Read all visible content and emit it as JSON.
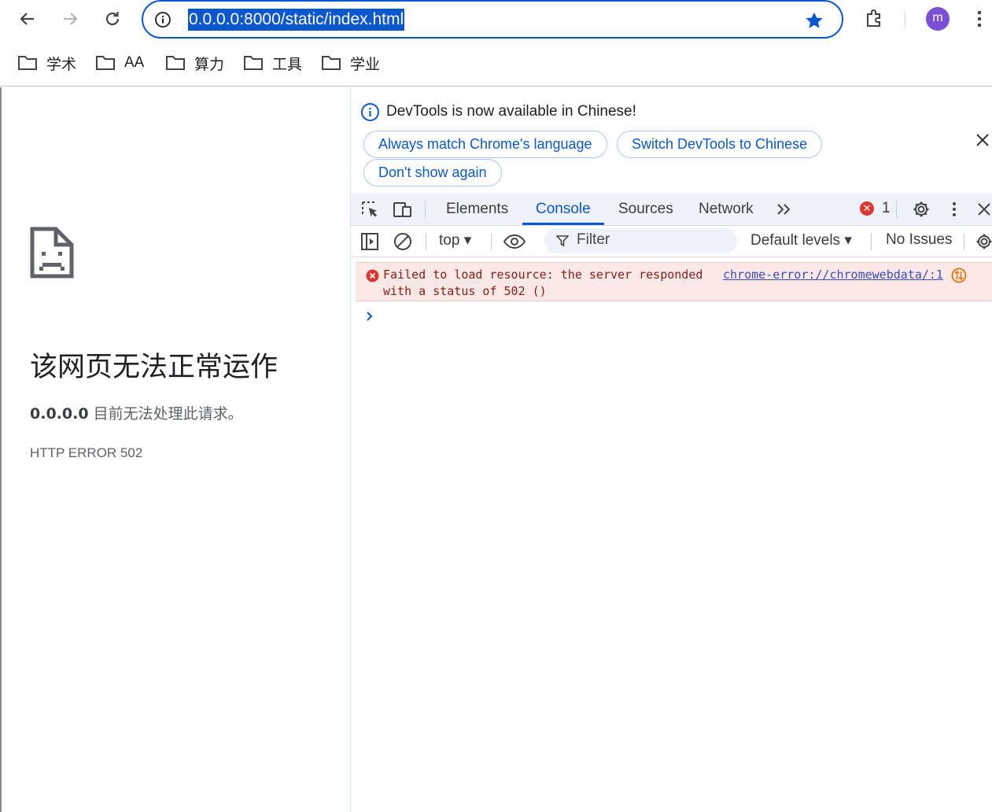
{
  "browser": {
    "url": "0.0.0.0:8000/static/index.html",
    "avatar_letter": "m",
    "accent_color": "#0b57d0"
  },
  "bookmarks": [
    {
      "label": "学术",
      "icon": "folder-icon"
    },
    {
      "label": "AA",
      "icon": "folder-icon"
    },
    {
      "label": "算力",
      "icon": "folder-icon"
    },
    {
      "label": "工具",
      "icon": "folder-icon"
    },
    {
      "label": "学业",
      "icon": "folder-icon"
    }
  ],
  "page": {
    "icon": "sad-document-icon",
    "title": "该网页无法正常运作",
    "host": "0.0.0.0",
    "description": "目前无法处理此请求。",
    "error_code": "HTTP ERROR 502"
  },
  "devtools": {
    "infobar": {
      "message": "DevTools is now available in Chinese!",
      "buttons": [
        "Always match Chrome's language",
        "Switch DevTools to Chinese",
        "Don't show again"
      ]
    },
    "tabs": [
      "Elements",
      "Console",
      "Sources",
      "Network"
    ],
    "active_tab": "Console",
    "error_count": "1",
    "filterbar": {
      "context": "top",
      "filter_placeholder": "Filter",
      "levels": "Default levels",
      "issues": "No Issues"
    },
    "messages": [
      {
        "level": "error",
        "text": "Failed to load resource: the server responded with a status of 502 ()",
        "source": "chrome-error://chromewebdata/:1"
      }
    ]
  }
}
